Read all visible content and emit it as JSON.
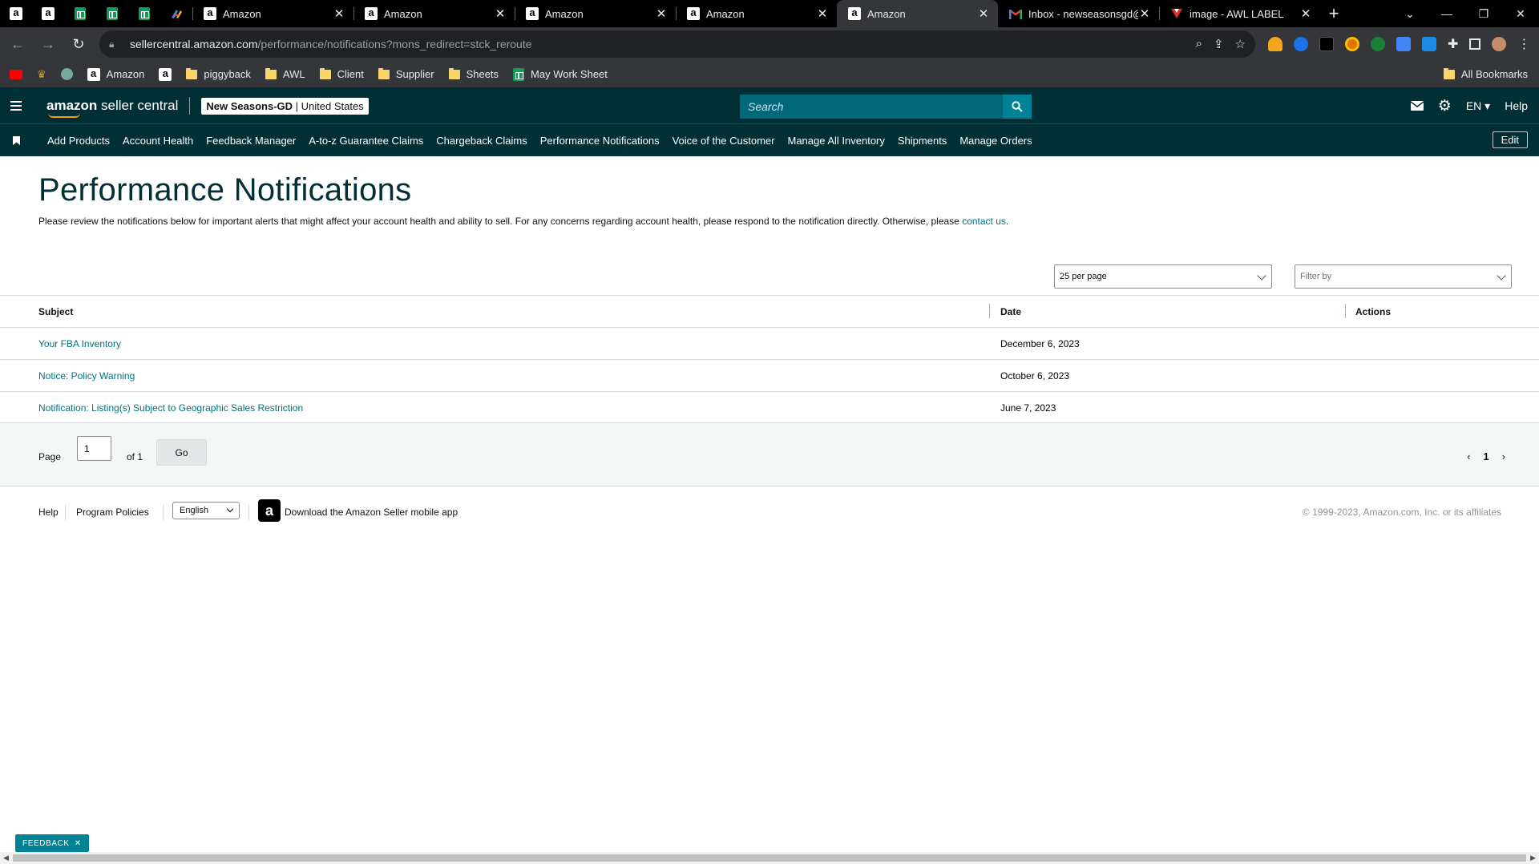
{
  "browser": {
    "tabs": [
      {
        "title": "Amazon",
        "active": false
      },
      {
        "title": "Amazon",
        "active": false
      },
      {
        "title": "Amazon",
        "active": false
      },
      {
        "title": "Amazon",
        "active": false
      },
      {
        "title": "Amazon",
        "active": true
      },
      {
        "title": "Inbox - newseasonsgd@",
        "active": false
      },
      {
        "title": "image - AWL LABEL",
        "active": false
      }
    ],
    "url_host": "sellercentral.amazon.com",
    "url_path": "/performance/notifications?mons_redirect=stck_reroute",
    "bookmarks": [
      "Amazon",
      "piggyback",
      "AWL",
      "Client",
      "Supplier",
      "Sheets",
      "May Work Sheet"
    ],
    "all_bookmarks_label": "All Bookmarks"
  },
  "header": {
    "logo_bold": "amazon",
    "logo_rest": " seller central",
    "store_name": "New Seasons-GD",
    "store_region": "United States",
    "search_placeholder": "Search",
    "language": "EN",
    "help": "Help"
  },
  "nav": {
    "items": [
      "Add Products",
      "Account Health",
      "Feedback Manager",
      "A-to-z Guarantee Claims",
      "Chargeback Claims",
      "Performance Notifications",
      "Voice of the Customer",
      "Manage All Inventory",
      "Shipments",
      "Manage Orders"
    ],
    "edit": "Edit"
  },
  "main": {
    "title": "Performance Notifications",
    "intro": "Please review the notifications below for important alerts that might affect your account health and ability to sell. For any concerns regarding account health, please respond to the notification directly. Otherwise, please",
    "contact_link": "contact us",
    "per_page": "25 per page",
    "filter_placeholder": "Filter by",
    "columns": {
      "subject": "Subject",
      "date": "Date",
      "actions": "Actions"
    },
    "rows": [
      {
        "subject": "Your FBA Inventory",
        "date": "December 6, 2023"
      },
      {
        "subject": "Notice: Policy Warning",
        "date": "October 6, 2023"
      },
      {
        "subject": "Notification: Listing(s) Subject to Geographic Sales Restriction",
        "date": "June 7, 2023"
      }
    ],
    "pager": {
      "page_label": "Page",
      "page_value": "1",
      "of_label": "of 1",
      "go": "Go",
      "current": "1"
    }
  },
  "footer": {
    "help": "Help",
    "policies": "Program Policies",
    "language": "English",
    "app_link": "Download the Amazon Seller mobile app",
    "copyright": "© 1999-2023, Amazon.com, Inc. or its affiliates"
  },
  "feedback": "FEEDBACK",
  "colors": {
    "header_bg": "#002f36",
    "link": "#007185",
    "search_bg": "#00687a",
    "accent": "#008296"
  }
}
